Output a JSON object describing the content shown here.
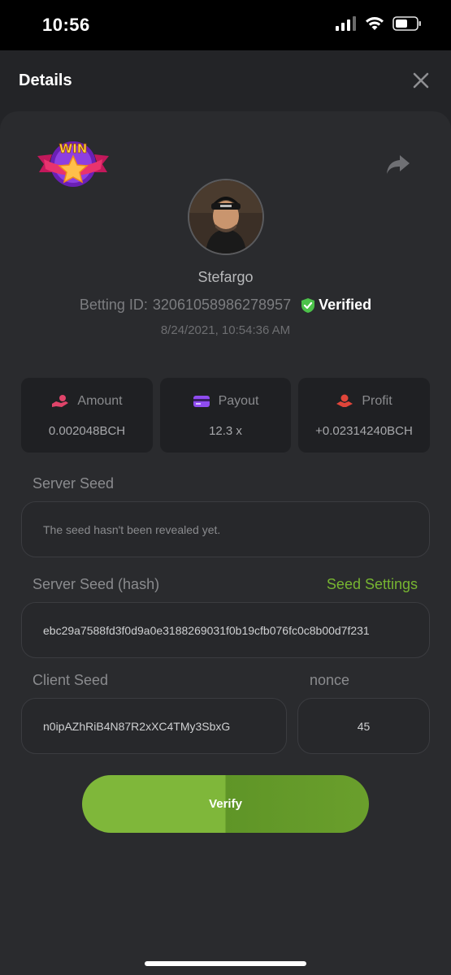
{
  "status_bar": {
    "time": "10:56"
  },
  "header": {
    "title": "Details"
  },
  "profile": {
    "username": "Stefargo",
    "betting_id_label": "Betting ID:",
    "betting_id": "32061058986278957",
    "verified_label": "Verified",
    "timestamp": "8/24/2021, 10:54:36 AM"
  },
  "badge": {
    "text": "WIN"
  },
  "stats": [
    {
      "label": "Amount",
      "value": "0.002048BCH",
      "icon": "coins-hand-icon"
    },
    {
      "label": "Payout",
      "value": "12.3 x",
      "icon": "card-icon"
    },
    {
      "label": "Profit",
      "value": "+0.02314240BCH",
      "icon": "money-hand-icon"
    }
  ],
  "server_seed": {
    "label": "Server Seed",
    "value": "The seed hasn't been revealed yet."
  },
  "server_seed_hash": {
    "label": "Server Seed (hash)",
    "settings_link": "Seed Settings",
    "value": "ebc29a7588fd3f0d9a0e3188269031f0b19cfb076fc0c8b00d7f231"
  },
  "client_seed": {
    "label": "Client Seed",
    "value": "n0ipAZhRiB4N87R2xXC4TMy3SbxG"
  },
  "nonce": {
    "label": "nonce",
    "value": "45"
  },
  "verify_button": {
    "label": "Verify"
  },
  "colors": {
    "accent_green": "#77b531",
    "verified_green": "#4cc24a",
    "card_bg": "#2a2b2e",
    "stat_bg": "#1f2023"
  }
}
